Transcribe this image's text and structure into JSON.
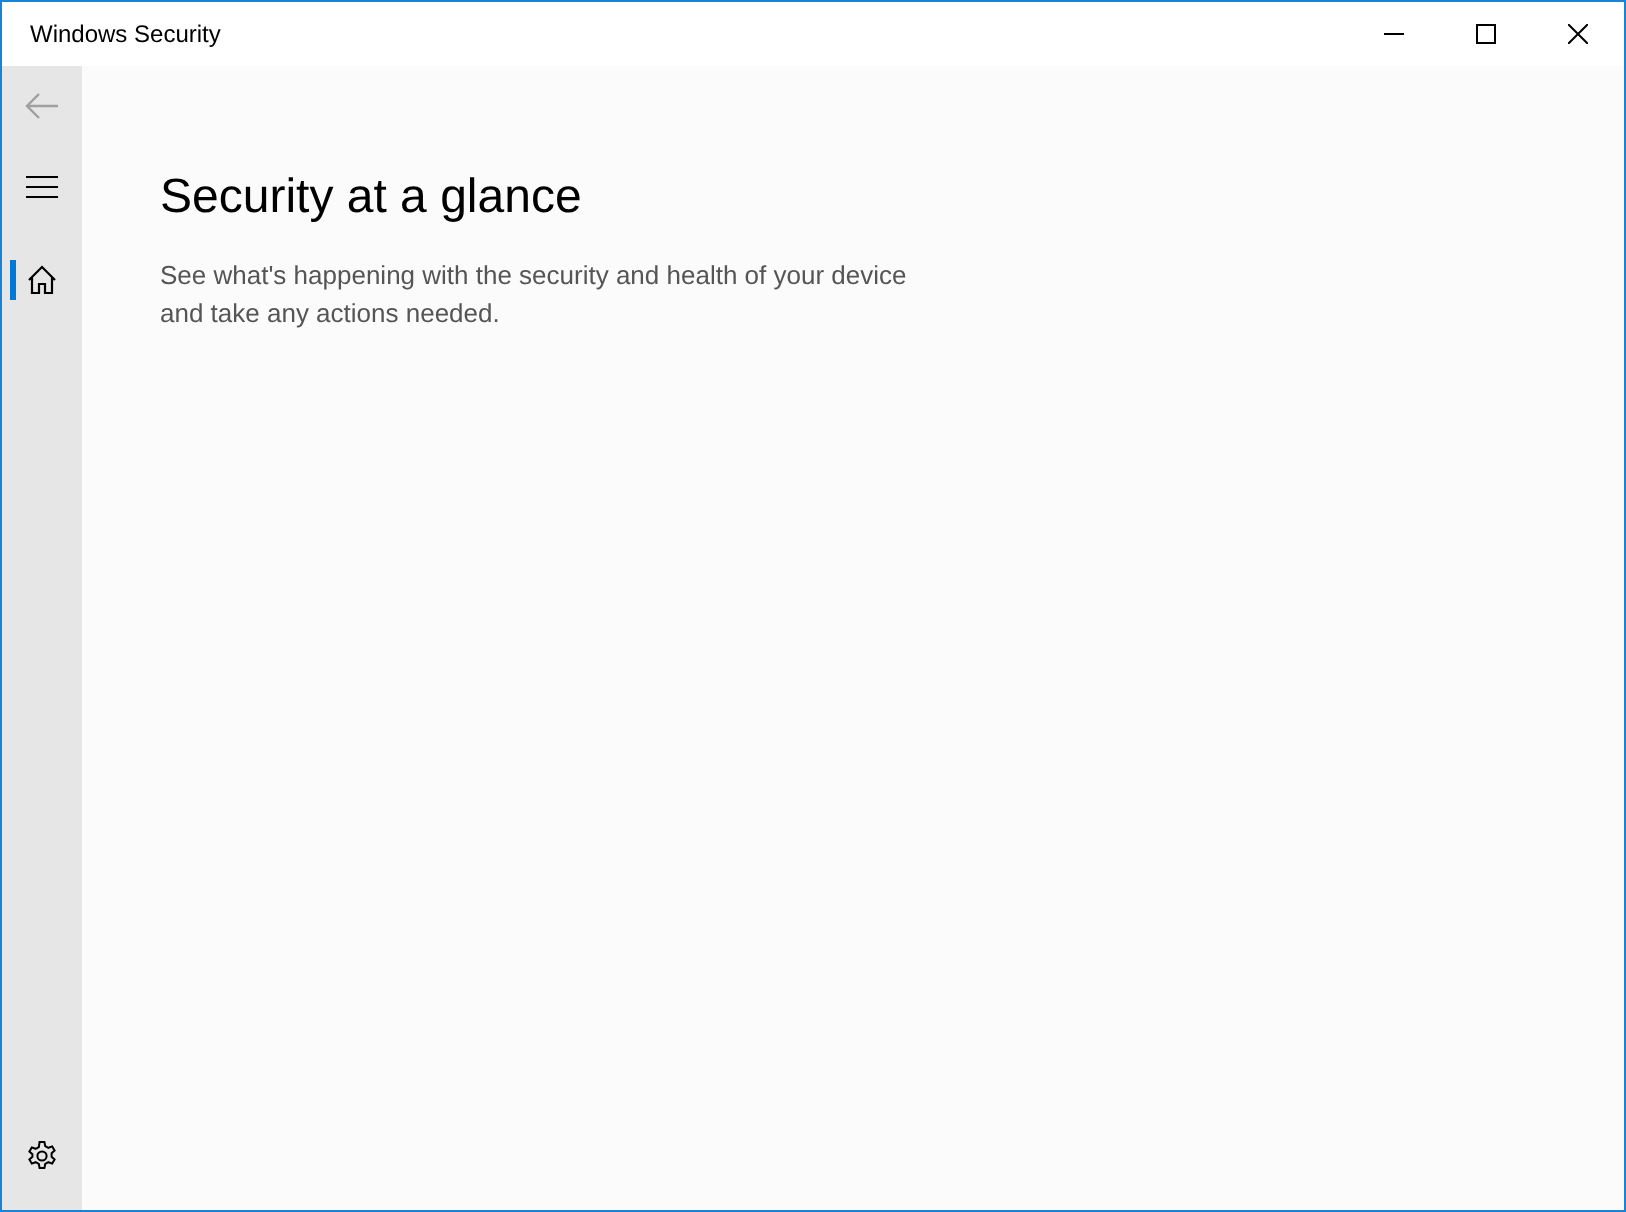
{
  "window": {
    "title": "Windows Security"
  },
  "sidebar": {
    "back": {
      "disabled": true
    },
    "items": [
      {
        "kind": "home",
        "selected": true
      },
      {
        "kind": "settings",
        "selected": false
      }
    ]
  },
  "page": {
    "heading": "Security at a glance",
    "description": "See what's happening with the security and health of your device and take any actions needed."
  }
}
